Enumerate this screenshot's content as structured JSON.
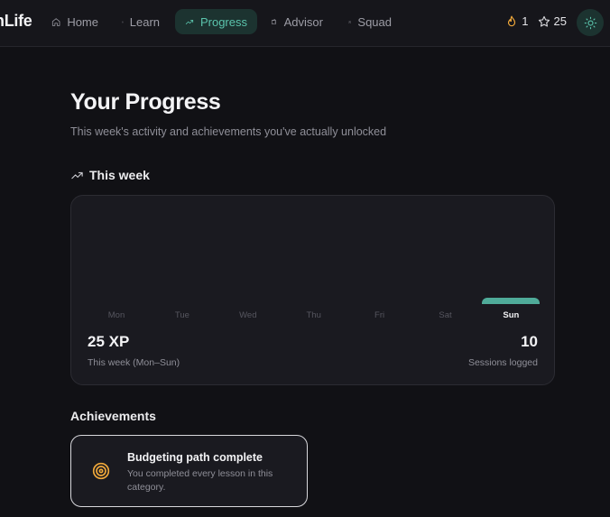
{
  "app": {
    "brand": "nLife"
  },
  "nav": {
    "items": [
      {
        "label": "Home",
        "icon": "home-icon"
      },
      {
        "label": "Learn",
        "icon": "map-icon"
      },
      {
        "label": "Progress",
        "icon": "trend-icon",
        "active": true
      },
      {
        "label": "Advisor",
        "icon": "wallet-icon"
      },
      {
        "label": "Squad",
        "icon": "users-icon"
      }
    ]
  },
  "stats": {
    "streak": "1",
    "stars": "25"
  },
  "page": {
    "title": "Your Progress",
    "subtitle": "This week's activity and achievements you've actually unlocked"
  },
  "week": {
    "heading": "This week",
    "xp_value": "25 XP",
    "xp_caption": "This week (Mon–Sun)",
    "sessions_value": "10",
    "sessions_caption": "Sessions logged"
  },
  "chart_data": {
    "type": "bar",
    "categories": [
      "Mon",
      "Tue",
      "Wed",
      "Thu",
      "Fri",
      "Sat",
      "Sun"
    ],
    "values": [
      0,
      0,
      0,
      0,
      0,
      0,
      25
    ],
    "highlight": "Sun",
    "ymax": 400
  },
  "achievements": {
    "heading": "Achievements",
    "items": [
      {
        "name": "Budgeting path complete",
        "description": "You completed every lesson in this category.",
        "icon": "target-icon"
      }
    ]
  },
  "colors": {
    "accent": "#5bc4ac",
    "bar": "#4fab99",
    "background": "#111115",
    "card": "#1a1a20",
    "streak": "#f0a83a"
  }
}
